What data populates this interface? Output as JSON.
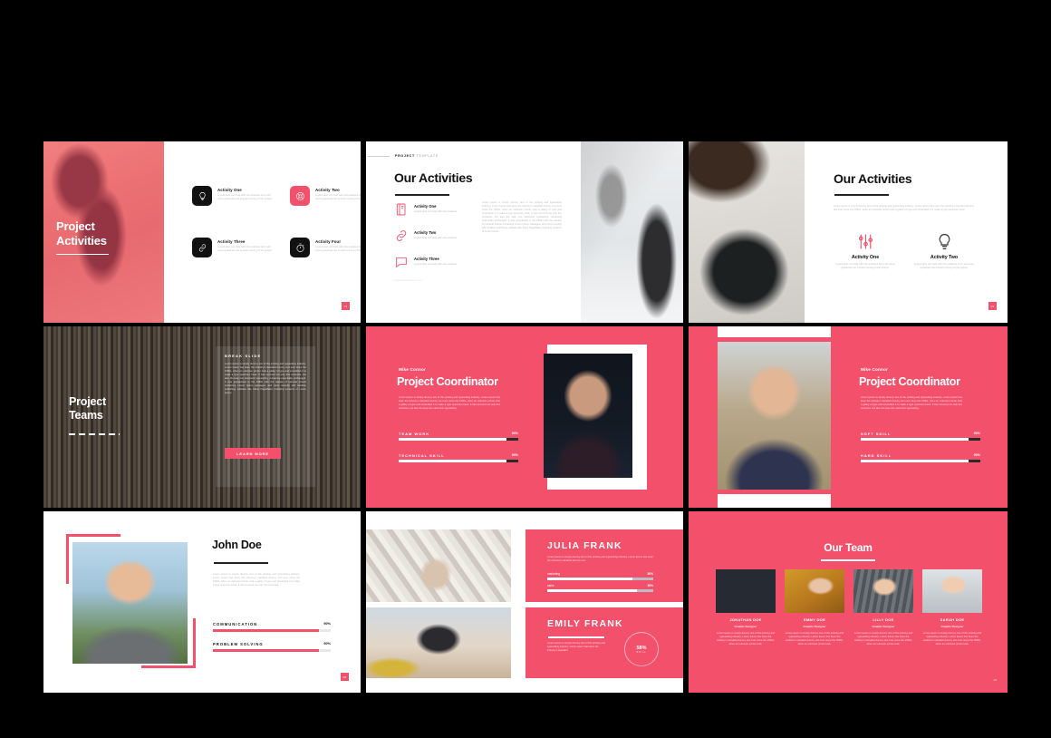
{
  "theme": {
    "accent": "#F2506B",
    "dark": "#111111",
    "page_bg": "#000000"
  },
  "deck": {
    "lorem_long": "Lorem ipsum is simply dummy text of the printing and typesetting industry. Lorem Ipsum has been the industry's standard dummy text ever since the 1500s, when an unknown printer took a galley of type and scrambled it to make a type specimen book. It has survived not only five centuries, but also the leap into electronic typesetting, remaining essentially unchanged. It was popularised in the 1960s with the release of Letraset sheets containing Lorem Ipsum passages, and more recently with desktop publishing software like Aldus PageMaker including versions of Lorem Ipsum.",
    "lorem_mid": "Lorem Ipsum is simply dummy text of the printing and typesetting industry. Lorem Ipsum has been the industry's standard dummy text ever since the 1500s, when an unknown printer took a galley of type and scrambled it to make a type specimen book. It has survived not only five centuries, but also the leap into electronic typesetting.",
    "lorem_short": "Lorem Ipsum is simply dummy text of the printing and typesetting industry. Lorem Ipsum has been the industry's standard dummy text ever since the 1500s, when an unknown printer took a galley of type and scrambled it to make a type specimen book.",
    "lorem_tiny": "A good plan can help with risk analyses but it will never guarantee the smooth running of the project.",
    "lorem_xtiny": "A good plan can help with risk analyses."
  },
  "slide1": {
    "title_line1": "Project",
    "title_line2": "Activities",
    "page_number": "01",
    "items": [
      {
        "icon": "lightbulb-icon",
        "title": "Activity One",
        "text": "A good plan can help with risk analyses but it will never guarantee the smooth running of the project."
      },
      {
        "icon": "lifebuoy-icon",
        "title": "Activity Two",
        "text": "A good plan can help with risk analyses but it will never guarantee the smooth running of the project."
      },
      {
        "icon": "link-icon",
        "title": "Activity Three",
        "text": "A good plan can help with risk analyses but it will never guarantee the smooth running of the project."
      },
      {
        "icon": "stopwatch-icon",
        "title": "Activity Four",
        "text": "A good plan can help with risk analyses but it will never guarantee the smooth running of the project."
      }
    ]
  },
  "slide2": {
    "kicker_bold": "PROJECT",
    "kicker_light": "TEMPLATE",
    "heading": "Our Activities",
    "footer": "www.websitename.com",
    "body": "Lorem ipsum is simply dummy text of the printing and typesetting industry. Lorem Ipsum has been the industry's standard dummy text ever since the 1500s, when an unknown printer took a galley of type and scrambled it to make a type specimen book. It has survived not only five centuries, but also the leap into electronic typesetting, remaining essentially unchanged. It was popularised in the 1960s with the release of Letraset sheets containing Lorem Ipsum passages, and more recently with desktop publishing software like Aldus PageMaker including versions of Lorem Ipsum.",
    "items": [
      {
        "icon": "notebook-icon",
        "title": "Activity One",
        "text": "A good plan can help with risk analyses."
      },
      {
        "icon": "link-icon",
        "title": "Activity Two",
        "text": "A good plan can help with risk analyses."
      },
      {
        "icon": "chat-icon",
        "title": "Activity Three",
        "text": "A good plan can help with risk analyses."
      }
    ]
  },
  "slide3": {
    "heading": "Our Activities",
    "body": "Lorem ipsum is simply dummy text of the printing and typesetting industry. Lorem Ipsum has been the industry's standard dummy text ever since the 1500s, when an unknown printer took a galley of type and scrambled it to make a type specimen book.",
    "page_number": "03",
    "items": [
      {
        "icon": "sliders-icon",
        "title": "Activity One",
        "text": "A good plan can help with risk analyses but it will never guarantee the smooth running of the project."
      },
      {
        "icon": "lightbulb-icon",
        "title": "Activity Two",
        "text": "A good plan can help with risk analyses but it will never guarantee the smooth running of the project."
      }
    ]
  },
  "slide4": {
    "title_line1": "Project",
    "title_line2": "Teams",
    "panel_kicker": "BREAK SLIDE",
    "panel_body": "Lorem Ipsum is simply dummy text of the printing and typesetting industry. Lorem Ipsum has been the industry's standard dummy text ever since the 1500s, when an unknown printer took a galley of type and scrambled it to make a type specimen book. It has survived not only five centuries, but also the leap into electronic typesetting, remaining essentially unchanged. It was popularised in the 1960s with the release of Letraset sheets containing Lorem Ipsum passages, and more recently with desktop publishing software like Aldus PageMaker including versions of Lorem Ipsum.",
    "button_label": "LEARN MORE"
  },
  "slide5": {
    "name": "Mike Connor",
    "role": "Project Coordinator",
    "body": "Lorem Ipsum is simply dummy text of the printing and typesetting industry. Lorem Ipsum has been the industry's standard dummy text ever since the 1500s, when an unknown printer took a galley of type and scrambled it to make a type specimen book. It has survived not only five centuries, but also the leap into electronic typesetting.",
    "skills": [
      {
        "label": "TEAM WORK",
        "value": "90%",
        "pct": 90
      },
      {
        "label": "TECHNICAL SKILL",
        "value": "90%",
        "pct": 90
      }
    ]
  },
  "slide6": {
    "name": "Mike Connor",
    "role": "Project Coordinator",
    "body": "Lorem Ipsum is simply dummy text of the printing and typesetting industry. Lorem Ipsum has been the industry's standard dummy text ever since the 1500s, when an unknown printer took a galley of type and scrambled it to make a type specimen book. It has survived not only five centuries, but also the leap into electronic typesetting.",
    "skills": [
      {
        "label": "SOFT SKILL",
        "value": "90%",
        "pct": 90
      },
      {
        "label": "HARD SKILL",
        "value": "90%",
        "pct": 90
      }
    ]
  },
  "slide7": {
    "name": "John Doe",
    "body": "Lorem ipsum is simply dummy text of the printing and typesetting industry. Lorem Ipsum has been the industry's standard dummy text ever since the 1500s, when an unknown printer took a galley of type and scrambled it to make a type specimen book. It has survived not only five centuries.",
    "page_number": "06",
    "skills": [
      {
        "label": "COMMUNICATION",
        "value": "90%",
        "pct": 90
      },
      {
        "label": "PROBLEM SOLVING",
        "value": "90%",
        "pct": 90
      }
    ]
  },
  "slide8": {
    "card1": {
      "name": "JULIA FRANK",
      "body": "Lorem Ipsum is simply dummy text of the printing and typesetting industry. Lorem Ipsum has been the industry's standard dummy text.",
      "skills": [
        {
          "label": "marketing",
          "value": "80%",
          "pct": 80
        },
        {
          "label": "sales",
          "value": "85%",
          "pct": 85
        }
      ]
    },
    "card2": {
      "name": "EMILY FRANK",
      "body": "Lorem Ipsum is simply dummy text of the printing and typesetting industry. Lorem Ipsum has been the industry's standard",
      "donut_value": "58%",
      "donut_label": "SKILL",
      "donut_pct": 58
    }
  },
  "slide9": {
    "title": "Our Team",
    "page_number": "09",
    "members": [
      {
        "name": "JONATHAN DOE",
        "role": "Graphic Designer",
        "text": "Lorem ipsum is simply dummy text of the printing and typesetting industry. Lorem Ipsum has been the industry's standard dummy text ever since the 1500s, when an unknown printer took."
      },
      {
        "name": "EMMY DOE",
        "role": "Graphic Designer",
        "text": "Lorem ipsum is simply dummy text of the printing and typesetting industry. Lorem Ipsum has been the industry's standard dummy text ever since the 1500s, when an unknown printer took."
      },
      {
        "name": "LILLY DOE",
        "role": "Graphic Designer",
        "text": "Lorem ipsum is simply dummy text of the printing and typesetting industry. Lorem Ipsum has been the industry's standard dummy text ever since the 1500s, when an unknown printer took."
      },
      {
        "name": "SARAH DOE",
        "role": "Graphic Designer",
        "text": "Lorem ipsum is simply dummy text of the printing and typesetting industry. Lorem Ipsum has been the industry's standard dummy text ever since the 1500s, when an unknown printer took."
      }
    ]
  }
}
